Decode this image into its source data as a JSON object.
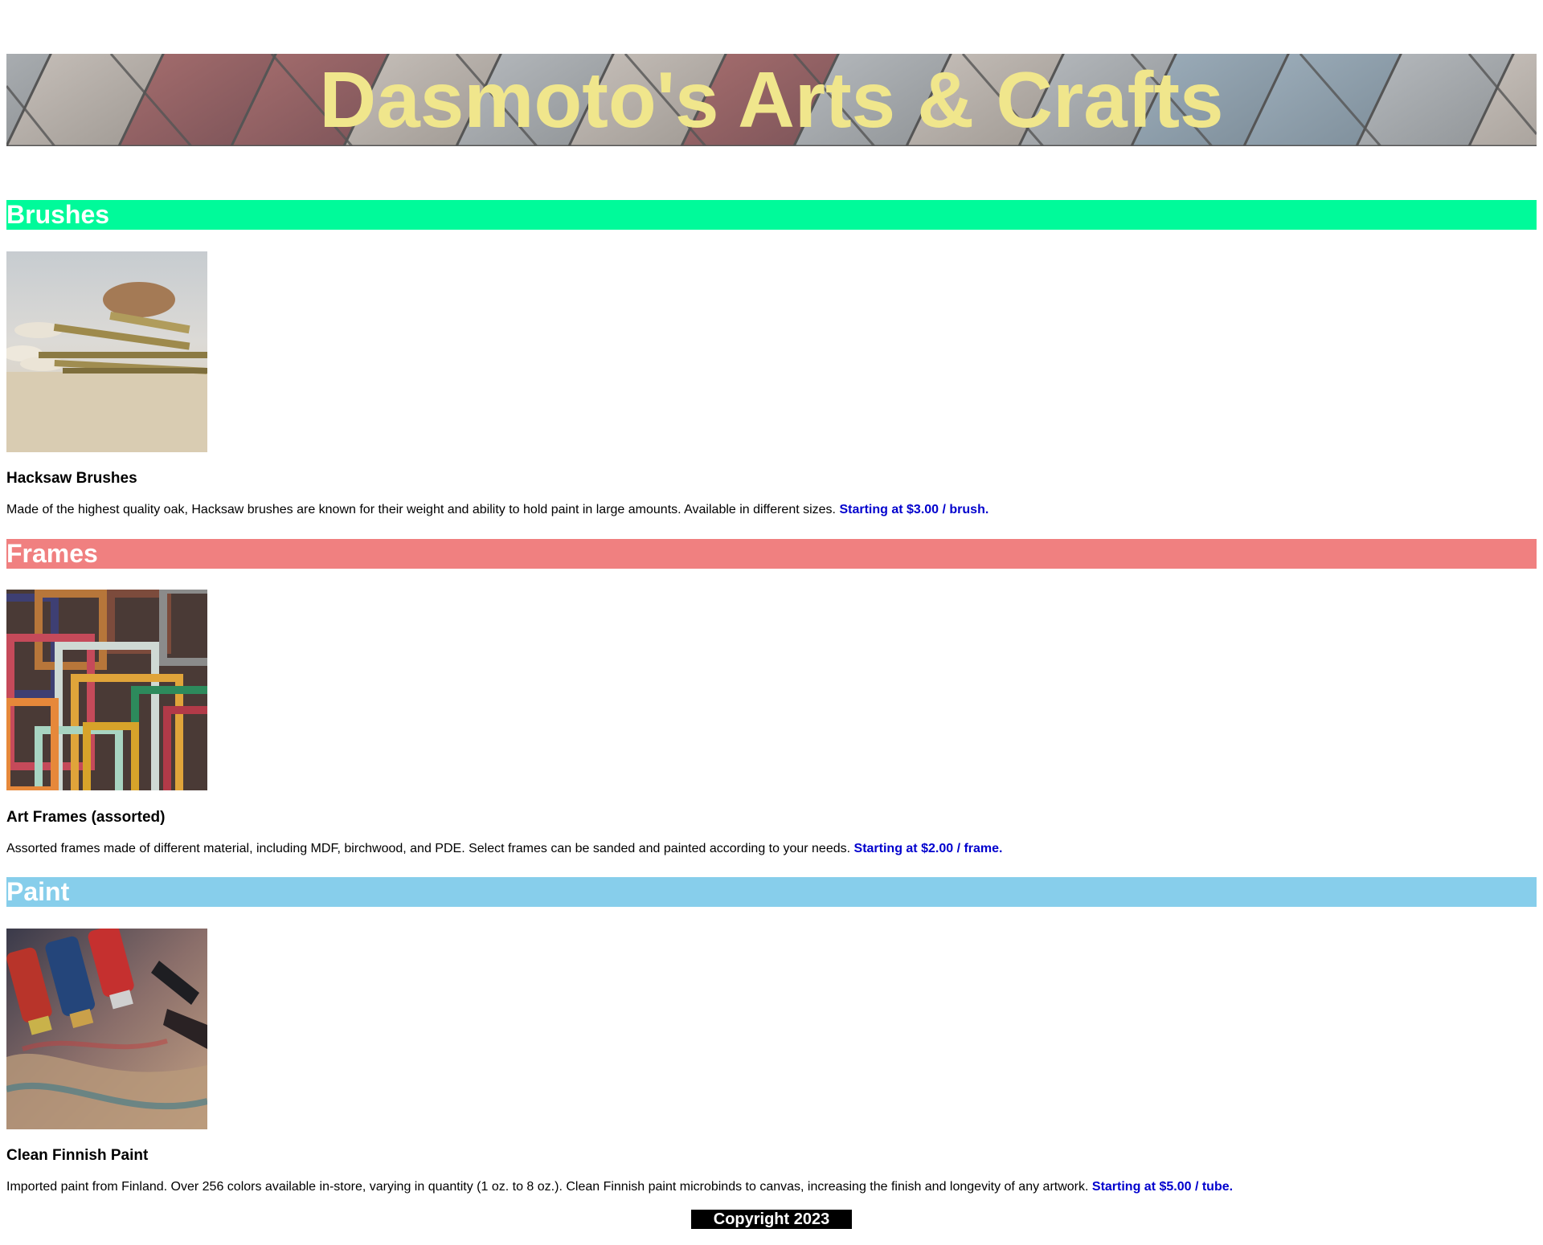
{
  "header": {
    "title": "Dasmoto's Arts & Crafts",
    "title_color": "#f0e68c"
  },
  "sections": [
    {
      "heading": "Brushes",
      "color": "#00fa9a",
      "image_icon": "paintbrushes-image",
      "product_name": "Hacksaw Brushes",
      "description": "Made of the highest quality oak, Hacksaw brushes are known for their weight and ability to hold paint in large amounts. Available in different sizes.",
      "price": "Starting at $3.00 / brush."
    },
    {
      "heading": "Frames",
      "color": "#f08080",
      "image_icon": "picture-frames-image",
      "product_name": "Art Frames (assorted)",
      "description": "Assorted frames made of different material, including MDF, birchwood, and PDE. Select frames can be sanded and painted according to your needs.",
      "price": "Starting at $2.00 / frame."
    },
    {
      "heading": "Paint",
      "color": "#87ceeb",
      "image_icon": "paint-tubes-image",
      "product_name": "Clean Finnish Paint",
      "description": "Imported paint from Finland. Over 256 colors available in-store, varying in quantity (1 oz. to 8 oz.). Clean Finnish paint microbinds to canvas, increasing the finish and longevity of any artwork.",
      "price": "Starting at $5.00 / tube."
    }
  ],
  "footer": {
    "text": "Copyright 2023"
  },
  "colors": {
    "price": "#0000cd",
    "footer_bg": "#000000"
  }
}
